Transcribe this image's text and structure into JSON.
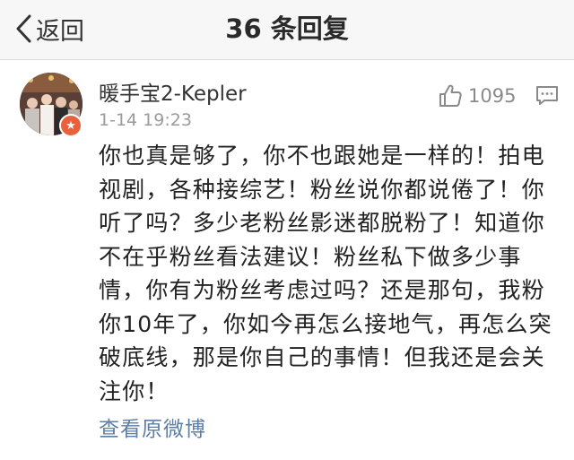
{
  "navbar": {
    "back_label": "返回",
    "title": "36 条回复"
  },
  "comment": {
    "avatar_icon": "user-avatar",
    "badge_icon": "star-badge",
    "username": "暖手宝2-Kepler",
    "timestamp": "1-14 19:23",
    "like_icon": "thumbs-up-icon",
    "like_count": "1095",
    "reply_icon": "comment-icon",
    "text": "你也真是够了，你不也跟她是一样的！拍电视剧，各种接综艺！粉丝说你都说倦了！你听了吗？多少老粉丝影迷都脱粉了！知道你不在乎粉丝看法建议！粉丝私下做多少事情，你有为粉丝考虑过吗？还是那句，我粉你10年了，你如今再怎么接地气，再怎么突破底线，那是你自己的事情！但我还是会关注你！",
    "view_original_label": "查看原微博"
  },
  "colors": {
    "link": "#5d7ea6",
    "badge": "#e8603c",
    "muted": "#9b9b9b"
  }
}
